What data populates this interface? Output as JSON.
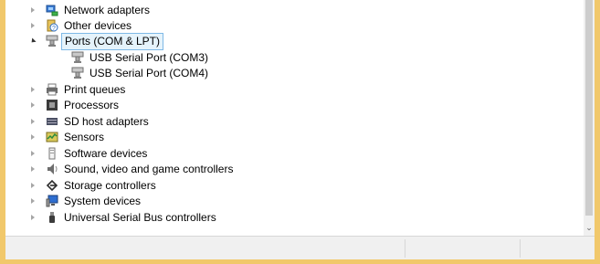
{
  "colors": {
    "selection_bg": "#e5f3fb",
    "selection_border": "#7fb9e6",
    "desktop": "#f1c86b"
  },
  "tree": {
    "items": [
      {
        "label": "Network adapters",
        "icon": "network-adapter-icon",
        "state": "collapsed"
      },
      {
        "label": "Other devices",
        "icon": "unknown-device-icon",
        "state": "collapsed"
      },
      {
        "label": "Ports (COM & LPT)",
        "icon": "port-icon",
        "state": "expanded",
        "selected": true,
        "children": [
          {
            "label": "USB Serial Port (COM3)",
            "icon": "port-icon"
          },
          {
            "label": "USB Serial Port (COM4)",
            "icon": "port-icon"
          }
        ]
      },
      {
        "label": "Print queues",
        "icon": "printer-icon",
        "state": "collapsed"
      },
      {
        "label": "Processors",
        "icon": "processor-icon",
        "state": "collapsed"
      },
      {
        "label": "SD host adapters",
        "icon": "sd-host-adapter-icon",
        "state": "collapsed"
      },
      {
        "label": "Sensors",
        "icon": "sensor-icon",
        "state": "collapsed"
      },
      {
        "label": "Software devices",
        "icon": "software-device-icon",
        "state": "collapsed"
      },
      {
        "label": "Sound, video and game controllers",
        "icon": "speaker-icon",
        "state": "collapsed"
      },
      {
        "label": "Storage controllers",
        "icon": "storage-controller-icon",
        "state": "collapsed"
      },
      {
        "label": "System devices",
        "icon": "computer-icon",
        "state": "collapsed"
      },
      {
        "label": "Universal Serial Bus controllers",
        "icon": "usb-plug-icon",
        "state": "collapsed"
      }
    ]
  },
  "scrollbar": {
    "arrow": "⌄"
  }
}
